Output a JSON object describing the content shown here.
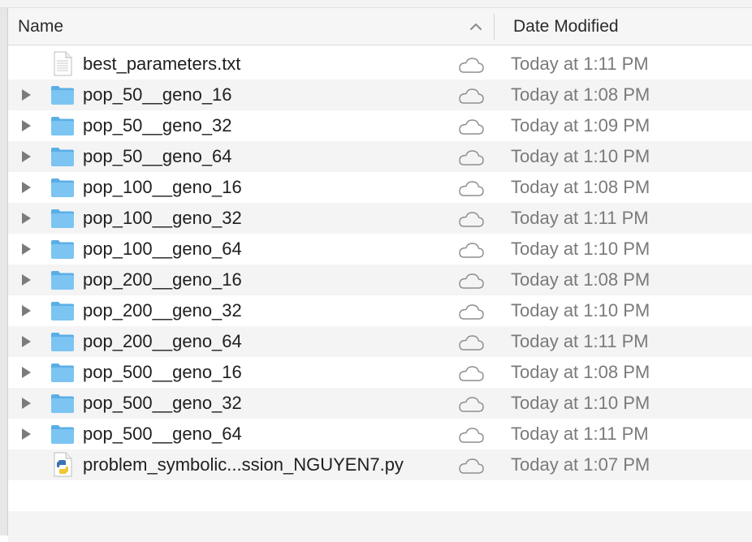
{
  "header": {
    "name_label": "Name",
    "date_label": "Date Modified",
    "sort_icon": "chevron-up-icon"
  },
  "rows": [
    {
      "name": "best_parameters.txt",
      "date": "Today at 1:11 PM",
      "kind": "text",
      "expandable": false
    },
    {
      "name": "pop_50__geno_16",
      "date": "Today at 1:08 PM",
      "kind": "folder",
      "expandable": true
    },
    {
      "name": "pop_50__geno_32",
      "date": "Today at 1:09 PM",
      "kind": "folder",
      "expandable": true
    },
    {
      "name": "pop_50__geno_64",
      "date": "Today at 1:10 PM",
      "kind": "folder",
      "expandable": true
    },
    {
      "name": "pop_100__geno_16",
      "date": "Today at 1:08 PM",
      "kind": "folder",
      "expandable": true
    },
    {
      "name": "pop_100__geno_32",
      "date": "Today at 1:11 PM",
      "kind": "folder",
      "expandable": true
    },
    {
      "name": "pop_100__geno_64",
      "date": "Today at 1:10 PM",
      "kind": "folder",
      "expandable": true
    },
    {
      "name": "pop_200__geno_16",
      "date": "Today at 1:08 PM",
      "kind": "folder",
      "expandable": true
    },
    {
      "name": "pop_200__geno_32",
      "date": "Today at 1:10 PM",
      "kind": "folder",
      "expandable": true
    },
    {
      "name": "pop_200__geno_64",
      "date": "Today at 1:11 PM",
      "kind": "folder",
      "expandable": true
    },
    {
      "name": "pop_500__geno_16",
      "date": "Today at 1:08 PM",
      "kind": "folder",
      "expandable": true
    },
    {
      "name": "pop_500__geno_32",
      "date": "Today at 1:10 PM",
      "kind": "folder",
      "expandable": true
    },
    {
      "name": "pop_500__geno_64",
      "date": "Today at 1:11 PM",
      "kind": "folder",
      "expandable": true
    },
    {
      "name": "problem_symbolic...ssion_NGUYEN7.py",
      "date": "Today at 1:07 PM",
      "kind": "python",
      "expandable": false
    }
  ],
  "colors": {
    "folder": "#7cc4f2",
    "folder_dark": "#5aaee6",
    "date_text": "#7a7a7a",
    "alt_row": "#f4f4f5"
  }
}
